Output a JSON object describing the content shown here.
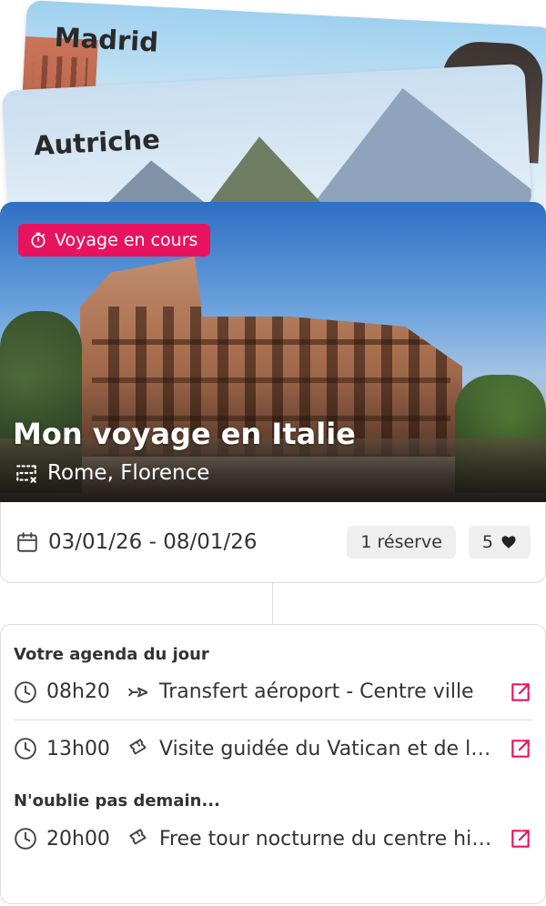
{
  "stack": {
    "cards": [
      {
        "title": "Madrid"
      },
      {
        "title": "Autriche"
      }
    ]
  },
  "hero": {
    "badge": {
      "icon": "timer-icon",
      "label": "Voyage en cours"
    },
    "title": "Mon voyage en Italie",
    "cities": "Rome, Florence",
    "cities_icon": "route-icon"
  },
  "info": {
    "dates_icon": "calendar-icon",
    "dates": "03/01/26 - 08/01/26",
    "reserve_chip": "1 réserve",
    "likes_count": "5",
    "likes_icon": "heart-icon"
  },
  "agenda": {
    "today_title": "Votre agenda du jour",
    "today": [
      {
        "time": "08h20",
        "category_icon": "transfer-icon",
        "label": "Transfert aéroport - Centre ville"
      },
      {
        "time": "13h00",
        "category_icon": "ticket-icon",
        "label": "Visite guidée du Vatican et de la chapelle Sixtine"
      }
    ],
    "tomorrow_title": "N'oublie pas demain...",
    "tomorrow": [
      {
        "time": "20h00",
        "category_icon": "ticket-icon",
        "label": "Free tour nocturne du centre historique"
      }
    ]
  },
  "colors": {
    "accent": "#e8135f",
    "chip_bg": "#efefef",
    "border": "#dddddd"
  }
}
